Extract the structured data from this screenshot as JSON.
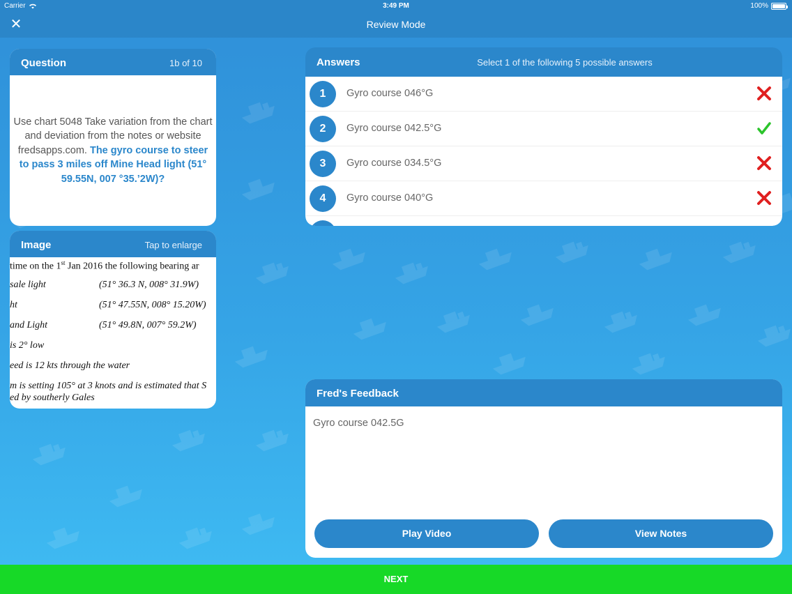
{
  "status_bar": {
    "carrier": "Carrier",
    "time": "3:49 PM",
    "battery": "100%"
  },
  "nav": {
    "title": "Review Mode"
  },
  "question": {
    "header": "Question",
    "progress": "1b of 10",
    "text_plain": "Use chart 5048 Take variation from the chart and deviation from the notes or website fredsapps.com.",
    "text_bold": "The gyro course to steer to pass 3 miles off Mine Head light (51° 59.55N, 007 °35.’2W)?"
  },
  "image": {
    "header": "Image",
    "hint": "Tap to enlarge",
    "lines": [
      {
        "text": "time on the 1",
        "sup": "st",
        "text_after": " Jan 2016 the following bearing ar"
      },
      {
        "label": "sale light",
        "coord": "(51° 36.3 N, 008° 31.9W)"
      },
      {
        "label": "ht",
        "coord": "(51° 47.55N, 008° 15.20W)"
      },
      {
        "label": "and Light",
        "coord": "(51° 49.8N, 007° 59.2W)"
      },
      {
        "label": " is 2° low"
      },
      {
        "label": "eed is 12 kts through the water"
      },
      {
        "label": "m is setting 105° at 3 knots and is estimated that S"
      },
      {
        "label": "ed by southerly Gales"
      }
    ]
  },
  "answers": {
    "header": "Answers",
    "instruction": "Select 1 of the following 5 possible answers",
    "items": [
      {
        "number": "1",
        "text": "Gyro course 046°G",
        "result": "wrong-icon"
      },
      {
        "number": "2",
        "text": "Gyro course 042.5°G",
        "result": "check-icon"
      },
      {
        "number": "3",
        "text": "Gyro course 034.5°G",
        "result": "wrong-icon"
      },
      {
        "number": "4",
        "text": "Gyro course 040°G",
        "result": "wrong-icon"
      }
    ]
  },
  "feedback": {
    "header": "Fred's Feedback",
    "text": "Gyro course 042.5G",
    "play_video": "Play Video",
    "view_notes": "View Notes"
  },
  "next": {
    "label": "NEXT"
  },
  "colors": {
    "primary": "#2b87cb",
    "next_green": "#17d927",
    "wrong_red": "#e02020",
    "correct_green": "#2bc42b"
  }
}
